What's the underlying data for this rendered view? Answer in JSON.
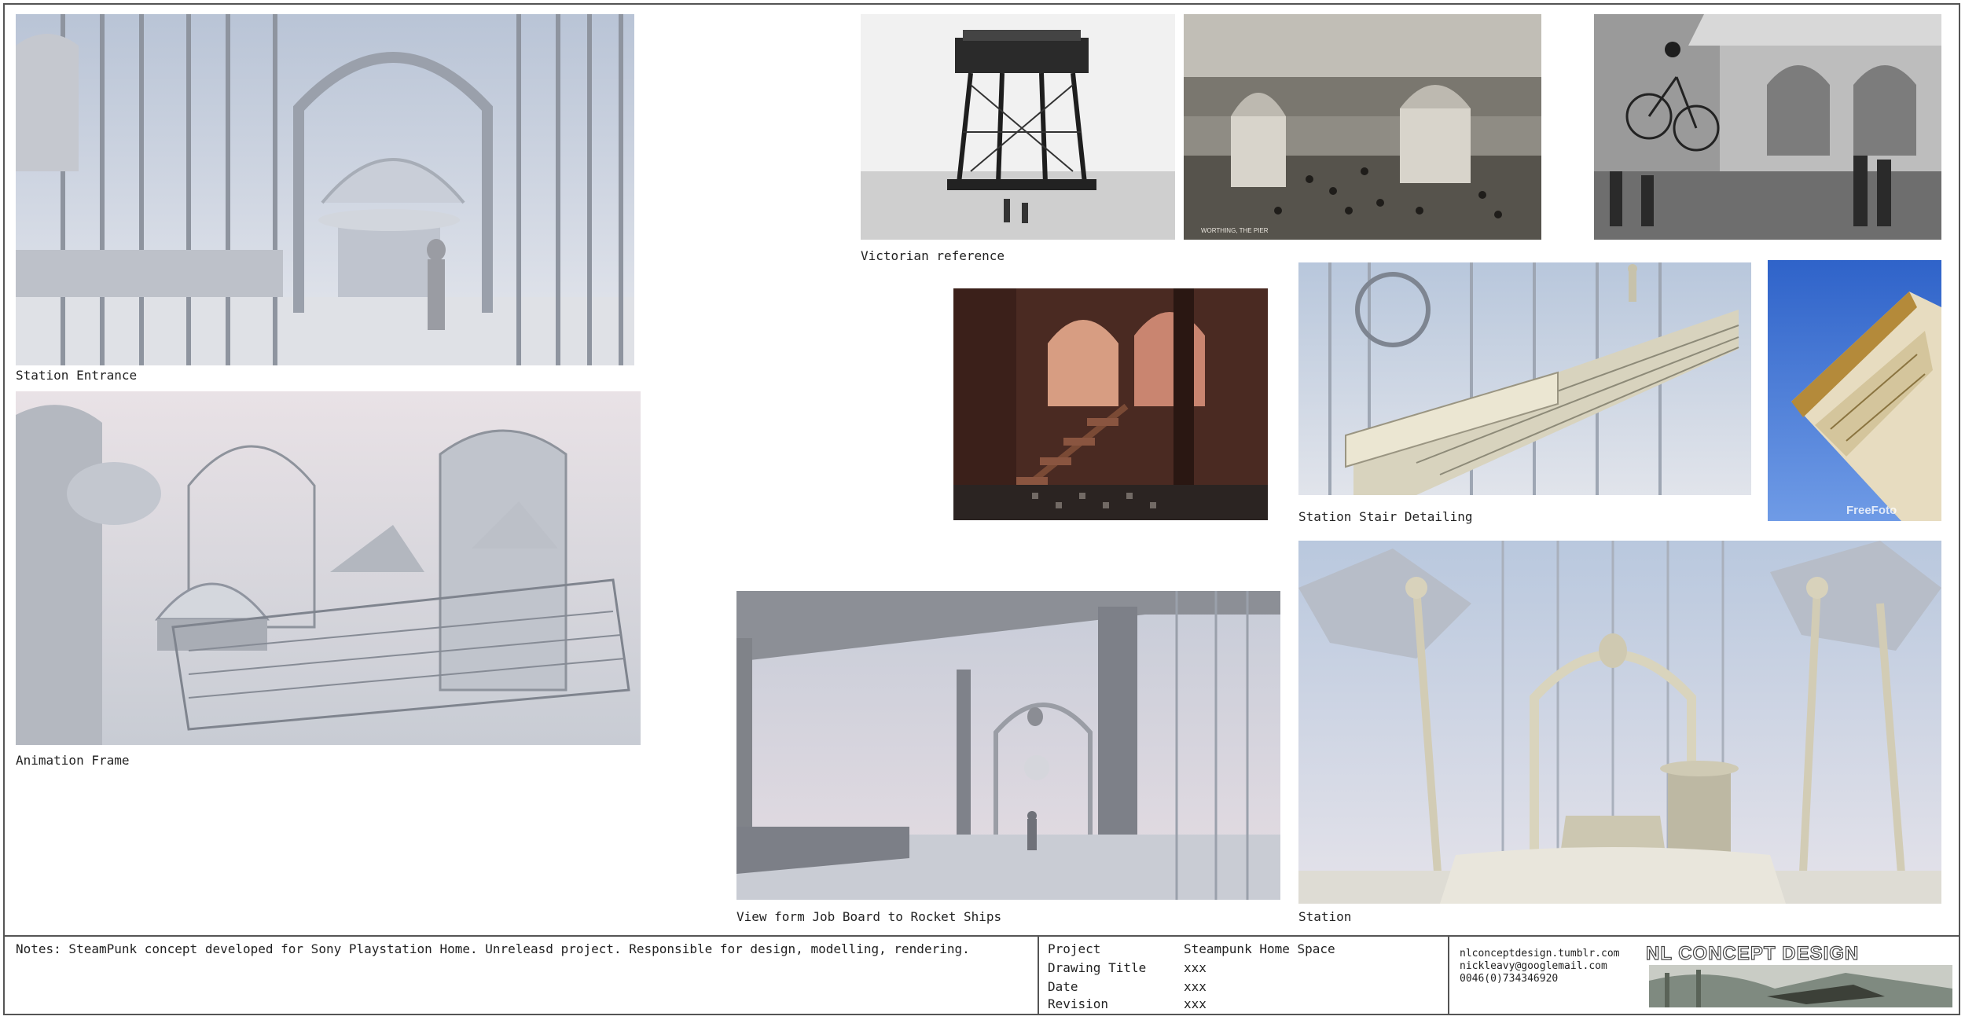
{
  "images": {
    "station_entrance": {
      "caption": "Station Entrance"
    },
    "animation_frame": {
      "caption": "Animation Frame"
    },
    "victorian_tower": {
      "caption": "Victorian reference"
    },
    "worthing_pier": {
      "caption": "",
      "photo_text": "WORTHING, THE PIER"
    },
    "cyclist_pavilion": {
      "caption": ""
    },
    "rusty_interior": {
      "caption": ""
    },
    "stair_detailing": {
      "caption": "Station Stair Detailing"
    },
    "eaves_photo": {
      "caption": "",
      "watermark": "FreeFoto"
    },
    "job_board_view": {
      "caption": "View form Job Board to Rocket Ships"
    },
    "station": {
      "caption": "Station"
    }
  },
  "title_block": {
    "notes": "Notes:  SteamPunk concept developed for Sony Playstation Home. Unreleasd project. Responsible for design, modelling, rendering.",
    "fields": [
      {
        "label": "Project",
        "value": "Steampunk Home Space"
      },
      {
        "label": "Drawing Title",
        "value": "xxx"
      },
      {
        "label": "Date",
        "value": "xxx"
      },
      {
        "label": "Revision",
        "value": "xxx"
      }
    ],
    "contact": [
      "nlconceptdesign.tumblr.com",
      "nickleavy@googlemail.com",
      "0046(0)734346920"
    ],
    "brand": "NL CONCEPT DESIGN"
  }
}
